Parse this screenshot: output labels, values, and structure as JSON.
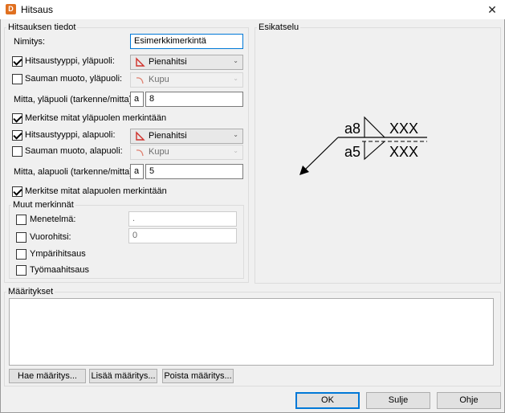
{
  "window": {
    "title": "Hitsaus",
    "icon_letter": "D"
  },
  "weld_info": {
    "legend": "Hitsauksen tiedot",
    "name_label": "Nimitys:",
    "name_value": "Esimerkkimerkintä",
    "upper_type_label": "Hitsaustyyppi, yläpuoli:",
    "upper_type_checked": true,
    "upper_type_value": "Pienahitsi",
    "upper_shape_label": "Sauman muoto, yläpuoli:",
    "upper_shape_checked": false,
    "upper_shape_value": "Kupu",
    "upper_dim_label": "Mitta, yläpuoli (tarkenne/mitta):",
    "upper_prefix": "a",
    "upper_size": "8",
    "mark_upper_label": "Merkitse mitat yläpuolen merkintään",
    "mark_upper_checked": true,
    "lower_type_label": "Hitsaustyyppi, alapuoli:",
    "lower_type_checked": true,
    "lower_type_value": "Pienahitsi",
    "lower_shape_label": "Sauman muoto, alapuoli:",
    "lower_shape_checked": false,
    "lower_shape_value": "Kupu",
    "lower_dim_label": "Mitta, alapuoli (tarkenne/mitta):",
    "lower_prefix": "a",
    "lower_size": "5",
    "mark_lower_label": "Merkitse mitat alapuolen merkintään",
    "mark_lower_checked": true
  },
  "other_marks": {
    "legend": "Muut merkinnät",
    "method_label": "Menetelmä:",
    "method_value": ".",
    "staggered_label": "Vuorohitsi:",
    "staggered_value": "0",
    "all_around_label": "Ympärihitsaus",
    "field_weld_label": "Työmaahitsaus"
  },
  "preview": {
    "legend": "Esikatselu",
    "upper_text": "a8",
    "upper_len": "XXX",
    "lower_text": "a5",
    "lower_len": "XXX"
  },
  "definitions": {
    "legend": "Määritykset",
    "fetch_button": "Hae määritys...",
    "add_button": "Lisää määritys...",
    "remove_button": "Poista määritys..."
  },
  "footer": {
    "ok": "OK",
    "close": "Sulje",
    "help": "Ohje"
  },
  "colors": {
    "accent": "#0078d7",
    "weld_icon": "#d0302a",
    "shape_icon": "#e08070"
  }
}
